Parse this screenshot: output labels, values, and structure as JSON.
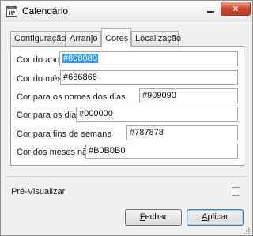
{
  "window": {
    "title": "Calendário",
    "close_glyph": "×",
    "minimize_icon": "minimize-icon",
    "app_icon": "calendar-icon"
  },
  "tabs": [
    {
      "label": "Configuração",
      "active": false
    },
    {
      "label": "Arranjo",
      "active": false
    },
    {
      "label": "Cores",
      "active": true
    },
    {
      "label": "Localização",
      "active": false
    }
  ],
  "colors": {
    "rows": [
      {
        "label": "Cor do ano",
        "value": "#808080",
        "selected": true
      },
      {
        "label": "Cor do mês",
        "value": "#686868"
      },
      {
        "label": "Cor para os nomes dos dias",
        "value": "#909090"
      },
      {
        "label": "Cor para os dias",
        "value": "#000000"
      },
      {
        "label": "Cor para fins de semana",
        "value": "#787878"
      },
      {
        "label": "Cor dos meses não atuais",
        "value": "#B0B0B0"
      }
    ]
  },
  "preview": {
    "label": "Pré-Visualizar",
    "checked": false
  },
  "buttons": {
    "close_first": "F",
    "close_rest": "echar",
    "apply_first": "A",
    "apply_rest": "plicar"
  },
  "accent": {
    "selection": "#3399ff",
    "close_button": "#c9462c"
  }
}
